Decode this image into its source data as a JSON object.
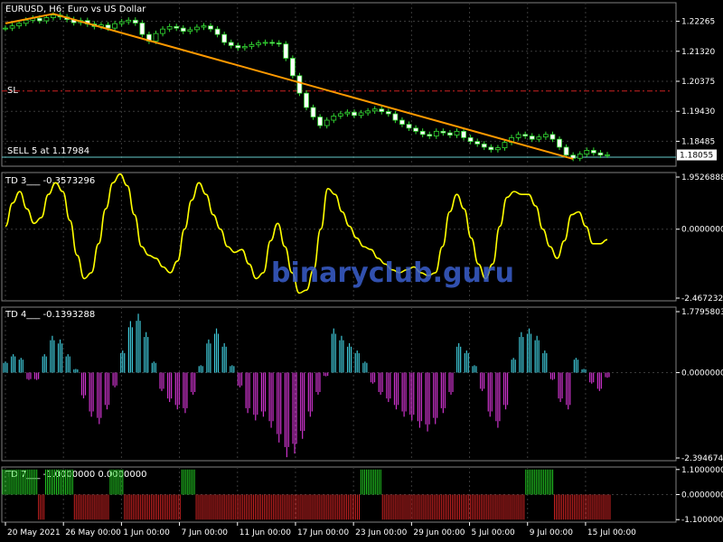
{
  "chart_data": {
    "type": "line",
    "main": {
      "title": "EURUSD, H6:  Euro vs US Dollar",
      "price_ticks": [
        "1.22265",
        "1.21320",
        "1.20375",
        "1.19430",
        "1.18485"
      ],
      "y_range": [
        1.177,
        1.2285
      ],
      "current_price": "1.18055",
      "sl_label": "SL",
      "sl_value": 1.2007,
      "sell_label": "SELL 5 at 1.17984",
      "sell_value": 1.17984,
      "close_series": [
        1.2205,
        1.2212,
        1.222,
        1.223,
        1.2236,
        1.2228,
        1.2238,
        1.2246,
        1.224,
        1.2232,
        1.2222,
        1.2229,
        1.2218,
        1.221,
        1.2215,
        1.2205,
        1.2219,
        1.2225,
        1.223,
        1.2221,
        1.2185,
        1.2164,
        1.2188,
        1.2202,
        1.221,
        1.2205,
        1.2195,
        1.22,
        1.2208,
        1.2212,
        1.2202,
        1.2185,
        1.216,
        1.215,
        1.2143,
        1.2147,
        1.2153,
        1.2158,
        1.216,
        1.2158,
        1.2155,
        1.211,
        1.2055,
        1.2,
        1.1955,
        1.1925,
        1.1898,
        1.1915,
        1.1928,
        1.1935,
        1.194,
        1.193,
        1.1938,
        1.1944,
        1.195,
        1.1942,
        1.1935,
        1.1915,
        1.1902,
        1.189,
        1.188,
        1.187,
        1.1865,
        1.188,
        1.1875,
        1.1868,
        1.188,
        1.186,
        1.1848,
        1.184,
        1.183,
        1.1822,
        1.1828,
        1.1845,
        1.186,
        1.187,
        1.1865,
        1.1855,
        1.1862,
        1.187,
        1.1855,
        1.183,
        1.1805,
        1.1795,
        1.1808,
        1.182,
        1.1812,
        1.1805,
        1.1806
      ],
      "trend_line": [
        {
          "i": 0,
          "price": 1.222
        },
        {
          "i": 7,
          "price": 1.225
        },
        {
          "i": 83,
          "price": 1.1793
        }
      ],
      "trend_color": "#ff9900"
    },
    "td3": {
      "title": "TD 3___ -0.3573296",
      "ticks": [
        "1.9526888",
        "0.0000000",
        "-2.4672326"
      ],
      "range": [
        -2.4672326,
        1.9526888
      ],
      "color": "#ffff00",
      "values": [
        0.1,
        0.9,
        1.3,
        0.7,
        0.2,
        0.4,
        1.2,
        1.6,
        1.3,
        0.3,
        -0.9,
        -1.7,
        -1.5,
        -0.5,
        0.7,
        1.6,
        1.9,
        1.5,
        0.5,
        -0.6,
        -0.9,
        -1.0,
        -1.3,
        -1.5,
        -1.1,
        0.0,
        1.0,
        1.6,
        1.2,
        0.5,
        0.0,
        -0.6,
        -0.8,
        -0.7,
        -1.2,
        -1.7,
        -1.5,
        -0.4,
        0.2,
        -0.6,
        -1.5,
        -2.2,
        -2.1,
        -1.4,
        0.0,
        1.4,
        1.2,
        0.6,
        0.1,
        -0.3,
        -0.6,
        -0.7,
        -1.0,
        -1.2,
        -1.4,
        -1.5,
        -1.4,
        -1.3,
        -1.5,
        -1.6,
        -1.5,
        -0.6,
        0.6,
        1.2,
        0.7,
        -0.3,
        -1.2,
        -1.7,
        -1.2,
        0.1,
        1.1,
        1.3,
        1.2,
        1.2,
        0.8,
        0.0,
        -0.6,
        -1.0,
        -0.4,
        0.5,
        0.6,
        0.1,
        -0.5,
        -0.5,
        -0.36
      ]
    },
    "td4": {
      "title": "TD 4___ -0.1393288",
      "ticks": [
        "1.7795803",
        "0.0000000",
        "-2.3946748"
      ],
      "range": [
        -2.3946748,
        1.7795803
      ],
      "pos_color": "#3ec6d6",
      "neg_color": "#cc33cc",
      "values": [
        0.3,
        0.5,
        0.4,
        -0.2,
        -0.2,
        0.5,
        1.0,
        0.9,
        0.5,
        0.1,
        -0.7,
        -1.2,
        -1.4,
        -1.0,
        -0.4,
        0.6,
        1.4,
        1.6,
        1.1,
        0.3,
        -0.5,
        -0.8,
        -1.0,
        -1.1,
        -0.6,
        0.2,
        0.9,
        1.2,
        0.8,
        0.2,
        -0.4,
        -1.1,
        -1.3,
        -1.2,
        -1.5,
        -1.9,
        -2.3,
        -2.2,
        -1.8,
        -1.2,
        -0.6,
        -0.1,
        1.2,
        1.0,
        0.8,
        0.6,
        0.3,
        -0.3,
        -0.6,
        -0.8,
        -1.0,
        -1.2,
        -1.3,
        -1.5,
        -1.6,
        -1.4,
        -1.1,
        -0.6,
        0.8,
        0.6,
        0.2,
        -0.5,
        -1.2,
        -1.5,
        -1.0,
        0.4,
        1.1,
        1.2,
        1.0,
        0.6,
        -0.2,
        -0.8,
        -1.0,
        0.4,
        0.1,
        -0.3,
        -0.5,
        -0.14
      ]
    },
    "td7": {
      "title": "TD 7___ -1.0000000 0.0000000",
      "ticks": [
        "1.1000000",
        "0.0000000",
        "-1.1000000"
      ],
      "range": [
        -1.1,
        1.1
      ],
      "pos_color": "#22cc22",
      "neg_color": "#cc2222",
      "values": [
        1,
        1,
        1,
        1,
        1,
        -1,
        1,
        1,
        1,
        1,
        -1,
        -1,
        -1,
        -1,
        -1,
        1,
        1,
        -1,
        -1,
        -1,
        -1,
        -1,
        -1,
        -1,
        -1,
        1,
        1,
        -1,
        -1,
        -1,
        -1,
        -1,
        -1,
        -1,
        -1,
        -1,
        -1,
        -1,
        -1,
        -1,
        -1,
        -1,
        -1,
        -1,
        -1,
        -1,
        -1,
        -1,
        -1,
        -1,
        1,
        1,
        1,
        -1,
        -1,
        -1,
        -1,
        -1,
        -1,
        -1,
        -1,
        -1,
        -1,
        -1,
        -1,
        -1,
        -1,
        -1,
        -1,
        -1,
        -1,
        -1,
        -1,
        1,
        1,
        1,
        1,
        -1,
        -1,
        -1,
        -1,
        -1,
        -1,
        -1,
        -1
      ]
    },
    "x_tick_labels": [
      "20 May 2021",
      "26 May 00:00",
      "1 Jun 00:00",
      "7 Jun 00:00",
      "11 Jun 00:00",
      "17 Jun 00:00",
      "23 Jun 00:00",
      "29 Jun 00:00",
      "5 Jul 00:00",
      "9 Jul 00:00",
      "15 Jul 00:00"
    ],
    "x_tick_index": [
      0,
      8,
      16,
      24,
      32,
      40,
      48,
      56,
      64,
      72,
      80
    ],
    "grid": true
  },
  "watermark": "binaryclub.guru"
}
